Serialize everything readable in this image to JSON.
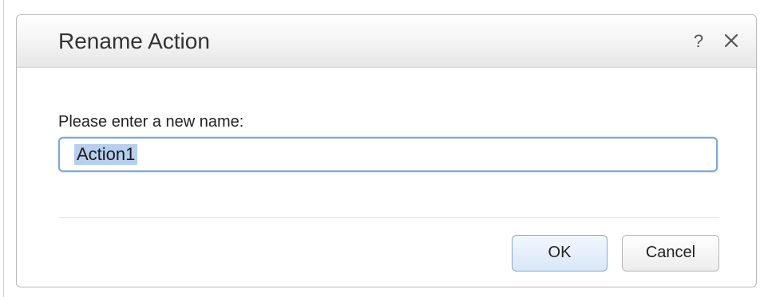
{
  "dialog": {
    "title": "Rename Action",
    "help_label": "?",
    "close_icon": "close-icon",
    "prompt_label": "Please enter a new name:",
    "input_value": "Action1",
    "ok_label": "OK",
    "cancel_label": "Cancel"
  },
  "colors": {
    "input_border": "#7fa6d8",
    "selection": "#b7cfee",
    "ok_button": "#d9e7f8"
  }
}
